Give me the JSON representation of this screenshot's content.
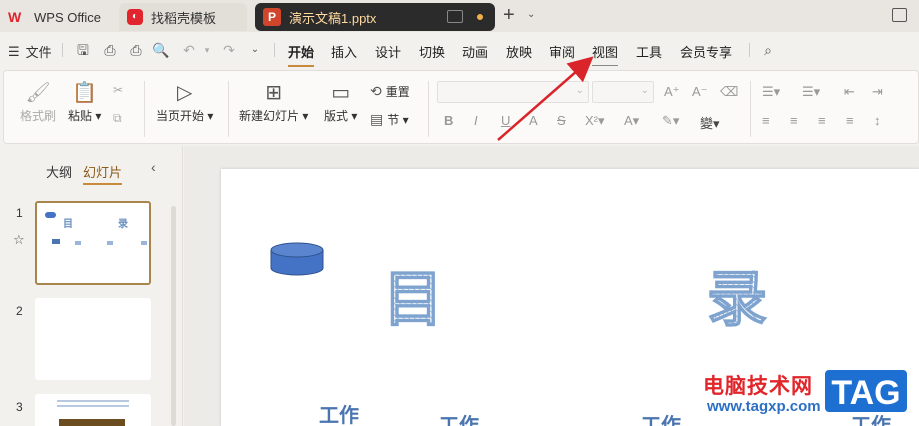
{
  "tabs": {
    "wps": "WPS Office",
    "template": "找稻壳模板",
    "document": "演示文稿1.pptx"
  },
  "menu": {
    "file": "文件",
    "items": [
      "开始",
      "插入",
      "设计",
      "切换",
      "动画",
      "放映",
      "审阅",
      "视图",
      "工具",
      "会员专享"
    ]
  },
  "ribbon": {
    "format_painter": "格式刷",
    "paste": "粘贴",
    "play_current": "当页开始",
    "new_slide": "新建幻灯片",
    "layout": "版式",
    "reset": "重置",
    "section": "节"
  },
  "left_panel": {
    "outline_tab": "大纲",
    "slides_tab": "幻灯片",
    "slide_numbers": [
      "1",
      "2",
      "3"
    ]
  },
  "thumb1": {
    "char1": "目",
    "char2": "录"
  },
  "slide": {
    "char1": "目",
    "char2": "录",
    "items": [
      "工作",
      "工作",
      "工作",
      "工作"
    ]
  },
  "watermark": {
    "site_name": "电脑技术网",
    "url": "www.tagxp.com",
    "tag": "TAG"
  },
  "colors": {
    "accent": "#c88a3c",
    "arrow": "#d9252a"
  }
}
